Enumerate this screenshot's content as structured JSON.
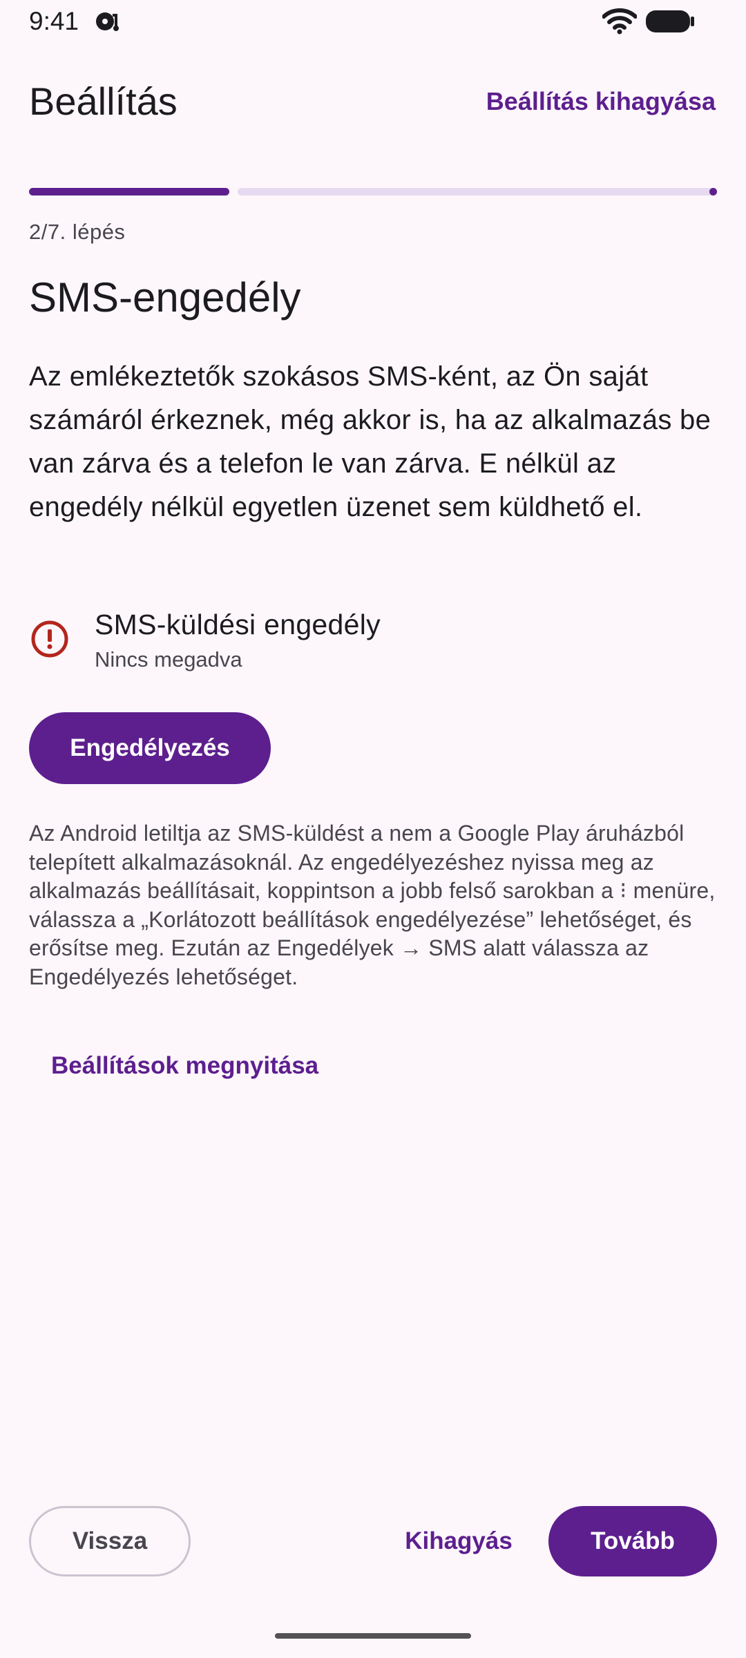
{
  "status_bar": {
    "time": "9:41",
    "notification_icon": "media-notification-icon",
    "wifi_icon": "wifi-icon",
    "battery_icon": "battery-icon"
  },
  "top_bar": {
    "title": "Beállítás",
    "skip_setup_label": "Beállítás kihagyása"
  },
  "progress": {
    "current_step": 2,
    "total_steps": 7,
    "label": "2/7. lépés"
  },
  "main": {
    "title": "SMS-engedély",
    "description": "Az emlékeztetők szokásos SMS-ként, az Ön saját számáról érkeznek, még akkor is, ha az alkalmazás be van zárva és a telefon le van zárva. E nélkül az engedély nélkül egyetlen üzenet sem küldhető el.",
    "permission": {
      "icon": "error-icon",
      "title": "SMS-küldési engedély",
      "status": "Nincs megadva"
    },
    "grant_button_label": "Engedélyezés",
    "info_text": "Az Android letiltja az SMS-küldést a nem a Google Play áruházból telepített alkalmazásoknál. Az engedélyezéshez nyissa meg az alkalmazás beállításait, koppintson a jobb felső sarokban a ⁝ menüre, válassza a „Korlátozott beállítások engedélyezése” lehetőséget, és erősítse meg. Ezután az Engedélyek → SMS alatt válassza az Engedélyezés lehetőséget.",
    "open_settings_label": "Beállítások megnyitása"
  },
  "bottom_bar": {
    "back_label": "Vissza",
    "skip_label": "Kihagyás",
    "next_label": "Tovább"
  },
  "colors": {
    "primary": "#5E1F8E",
    "background": "#FDF7FC",
    "progress_track": "#E6DAF0",
    "error": "#B3261E",
    "text": "#1C1B1F",
    "secondary_text": "#49454F"
  }
}
